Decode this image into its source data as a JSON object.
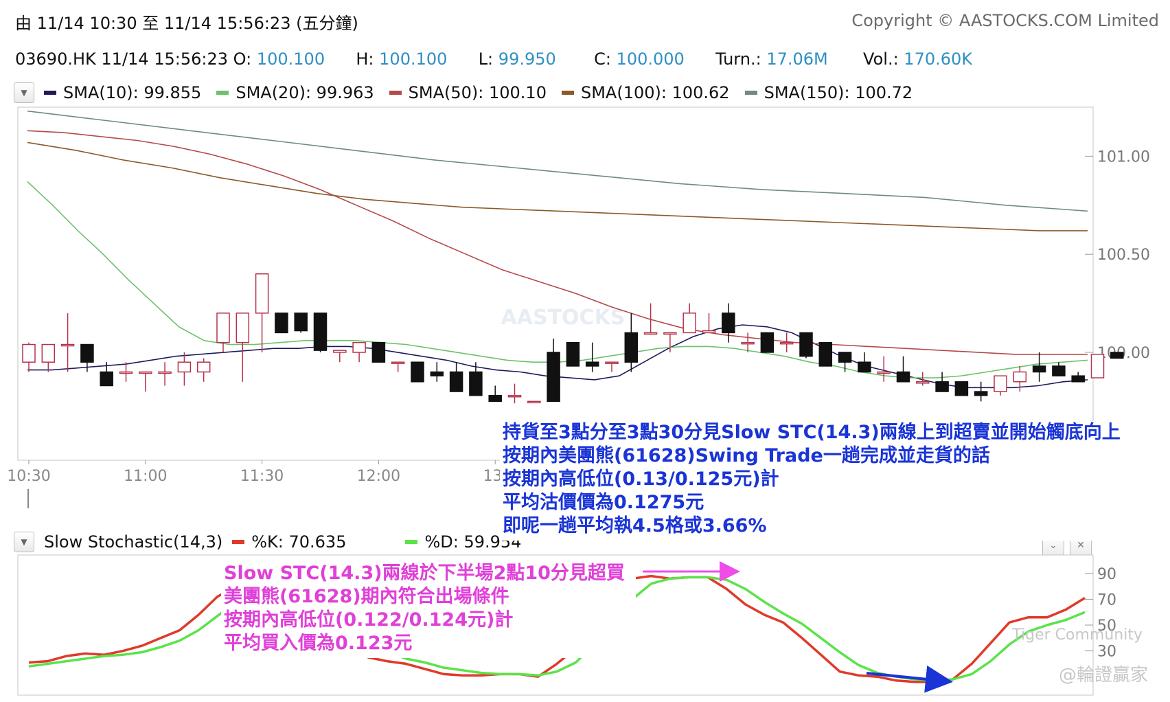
{
  "header": {
    "range_label": "由",
    "range_from": "11/14 10:30",
    "range_to_label": "至",
    "range_to": "11/14 15:56:23",
    "range_mode": "(五分鐘)",
    "copyright": "Copyright © AASTOCKS.COM Limited"
  },
  "quote": {
    "symbol": "03690.HK",
    "time": "11/14 15:56:23",
    "open_label": "O:",
    "open": "100.100",
    "high_label": "H:",
    "high": "100.100",
    "low_label": "L:",
    "low": "99.950",
    "close_label": "C:",
    "close": "100.000",
    "turnover_label": "Turn.:",
    "turnover": "17.06M",
    "volume_label": "Vol.:",
    "volume": "170.60K"
  },
  "sma_legend": [
    {
      "label": "SMA(10): 99.855",
      "color": "#1f1a5e"
    },
    {
      "label": "SMA(20): 99.963",
      "color": "#6cc26c"
    },
    {
      "label": "SMA(50): 100.10",
      "color": "#b5494a"
    },
    {
      "label": "SMA(100): 100.62",
      "color": "#8a5a2a"
    },
    {
      "label": "SMA(150): 100.72",
      "color": "#6f8a86"
    }
  ],
  "stoch_legend": {
    "name": "Slow Stochastic(14,3)",
    "k_label": "%K: 70.635",
    "k_color": "#e03a2a",
    "d_label": "%D: 59.954",
    "d_color": "#5be34a"
  },
  "notes": {
    "blue": [
      "持貨至3點分至3點30分見Slow STC(14.3)兩線上到超賣並開始觸底向上",
      "按期內美團熊(61628)Swing Trade一趟完成並走貨的話",
      "按期內高低位(0.13/0.125元)計",
      "平均沽價價為0.1275元",
      "即呢一趟平均執4.5格或3.66%"
    ],
    "pink": [
      "Slow STC(14.3)兩線於下半場2點10分見超買",
      "美團熊(61628)期內符合出場條件",
      "按期內高低位(0.122/0.124元)計",
      "平均買入價為0.123元"
    ]
  },
  "watermarks": {
    "center": "AASTOCKS",
    "tiger": "Tiger Community",
    "handle": "@輪證贏家"
  },
  "chart_data": [
    {
      "type": "candlestick",
      "interval": "5 minutes",
      "x_ticks": [
        "10:30",
        "11:00",
        "11:30",
        "12:00",
        "13:"
      ],
      "y_ticks": [
        "101.00",
        "100.50",
        "100.00"
      ],
      "ylim": [
        99.45,
        101.25
      ],
      "candles": [
        {
          "o": 99.95,
          "h": 100.05,
          "l": 99.9,
          "c": 100.04
        },
        {
          "o": 99.95,
          "h": 100.04,
          "l": 99.9,
          "c": 100.04
        },
        {
          "o": 100.04,
          "h": 100.2,
          "l": 99.9,
          "c": 100.04
        },
        {
          "o": 100.04,
          "h": 100.04,
          "l": 99.9,
          "c": 99.95
        },
        {
          "o": 99.9,
          "h": 99.95,
          "l": 99.83,
          "c": 99.83
        },
        {
          "o": 99.9,
          "h": 99.95,
          "l": 99.85,
          "c": 99.9
        },
        {
          "o": 99.9,
          "h": 99.9,
          "l": 99.8,
          "c": 99.9
        },
        {
          "o": 99.9,
          "h": 99.95,
          "l": 99.83,
          "c": 99.9
        },
        {
          "o": 99.9,
          "h": 100.0,
          "l": 99.83,
          "c": 99.95
        },
        {
          "o": 99.9,
          "h": 99.97,
          "l": 99.85,
          "c": 99.95
        },
        {
          "o": 100.05,
          "h": 100.2,
          "l": 100.0,
          "c": 100.2
        },
        {
          "o": 100.05,
          "h": 100.2,
          "l": 99.85,
          "c": 100.2
        },
        {
          "o": 100.2,
          "h": 100.35,
          "l": 100.0,
          "c": 100.4
        },
        {
          "o": 100.2,
          "h": 100.2,
          "l": 100.1,
          "c": 100.1
        },
        {
          "o": 100.2,
          "h": 100.2,
          "l": 100.1,
          "c": 100.11
        },
        {
          "o": 100.2,
          "h": 100.2,
          "l": 100.0,
          "c": 100.01
        },
        {
          "o": 100.0,
          "h": 100.0,
          "l": 99.95,
          "c": 100.01
        },
        {
          "o": 100.0,
          "h": 100.05,
          "l": 99.95,
          "c": 100.05
        },
        {
          "o": 100.05,
          "h": 100.05,
          "l": 99.95,
          "c": 99.95
        },
        {
          "o": 99.95,
          "h": 99.95,
          "l": 99.9,
          "c": 99.95
        },
        {
          "o": 99.95,
          "h": 99.95,
          "l": 99.85,
          "c": 99.85
        },
        {
          "o": 99.9,
          "h": 99.95,
          "l": 99.85,
          "c": 99.88
        },
        {
          "o": 99.9,
          "h": 99.95,
          "l": 99.83,
          "c": 99.8
        },
        {
          "o": 99.9,
          "h": 99.95,
          "l": 99.83,
          "c": 99.78
        },
        {
          "o": 99.78,
          "h": 99.83,
          "l": 99.75,
          "c": 99.75
        },
        {
          "o": 99.78,
          "h": 99.84,
          "l": 99.74,
          "c": 99.78
        },
        {
          "o": 99.75,
          "h": 99.75,
          "l": 99.75,
          "c": 99.75
        },
        {
          "o": 100.0,
          "h": 100.07,
          "l": 99.9,
          "c": 99.75
        },
        {
          "o": 100.05,
          "h": 100.05,
          "l": 99.95,
          "c": 99.93
        },
        {
          "o": 99.95,
          "h": 100.05,
          "l": 99.9,
          "c": 99.93
        },
        {
          "o": 99.95,
          "h": 99.9,
          "l": 99.9,
          "c": 99.95
        },
        {
          "o": 100.1,
          "h": 100.2,
          "l": 99.9,
          "c": 99.95
        },
        {
          "o": 100.1,
          "h": 100.25,
          "l": 100.1,
          "c": 100.1
        },
        {
          "o": 100.1,
          "h": 100.05,
          "l": 100.0,
          "c": 100.1
        },
        {
          "o": 100.1,
          "h": 100.25,
          "l": 100.1,
          "c": 100.2
        },
        {
          "o": 100.1,
          "h": 100.2,
          "l": 100.1,
          "c": 100.11
        },
        {
          "o": 100.2,
          "h": 100.25,
          "l": 100.05,
          "c": 100.1
        },
        {
          "o": 100.05,
          "h": 100.1,
          "l": 100.0,
          "c": 100.05
        },
        {
          "o": 100.1,
          "h": 100.1,
          "l": 100.0,
          "c": 100.0
        },
        {
          "o": 100.05,
          "h": 100.1,
          "l": 100.0,
          "c": 100.05
        },
        {
          "o": 100.1,
          "h": 100.1,
          "l": 99.97,
          "c": 99.98
        },
        {
          "o": 100.05,
          "h": 100.05,
          "l": 99.93,
          "c": 99.93
        },
        {
          "o": 100.0,
          "h": 100.0,
          "l": 99.9,
          "c": 99.95
        },
        {
          "o": 99.95,
          "h": 100.0,
          "l": 99.9,
          "c": 99.9
        },
        {
          "o": 99.9,
          "h": 99.98,
          "l": 99.85,
          "c": 99.9
        },
        {
          "o": 99.9,
          "h": 99.98,
          "l": 99.85,
          "c": 99.85
        },
        {
          "o": 99.85,
          "h": 99.9,
          "l": 99.83,
          "c": 99.85
        },
        {
          "o": 99.85,
          "h": 99.9,
          "l": 99.82,
          "c": 99.8
        },
        {
          "o": 99.85,
          "h": 99.85,
          "l": 99.78,
          "c": 99.78
        },
        {
          "o": 99.8,
          "h": 99.85,
          "l": 99.75,
          "c": 99.78
        },
        {
          "o": 99.8,
          "h": 99.85,
          "l": 99.78,
          "c": 99.88
        },
        {
          "o": 99.85,
          "h": 99.93,
          "l": 99.8,
          "c": 99.9
        },
        {
          "o": 99.93,
          "h": 100.0,
          "l": 99.85,
          "c": 99.9
        },
        {
          "o": 99.93,
          "h": 99.95,
          "l": 99.9,
          "c": 99.88
        },
        {
          "o": 99.88,
          "h": 99.9,
          "l": 99.85,
          "c": 99.85
        },
        {
          "o": 99.87,
          "h": 99.9,
          "l": 99.87,
          "c": 99.99
        },
        {
          "o": 100.0,
          "h": 100.0,
          "l": 99.97,
          "c": 99.97
        }
      ],
      "series": [
        {
          "name": "SMA(10)",
          "color": "#1f1a5e",
          "values": [
            99.91,
            99.91,
            99.92,
            99.93,
            99.94,
            99.96,
            99.98,
            99.99,
            100.0,
            100.01,
            100.02,
            100.02,
            100.03,
            100.03,
            100.02,
            100.0,
            99.98,
            99.96,
            99.93,
            99.91,
            99.9,
            99.88,
            99.87,
            99.86,
            99.88,
            99.95,
            100.02,
            100.08,
            100.12,
            100.14,
            100.13,
            100.1,
            100.04,
            99.98,
            99.93,
            99.9,
            99.87,
            99.84,
            99.82,
            99.82,
            99.82,
            99.83,
            99.85,
            99.86
          ]
        },
        {
          "name": "SMA(20)",
          "color": "#6cc26c",
          "values": [
            100.87,
            100.75,
            100.62,
            100.5,
            100.37,
            100.25,
            100.13,
            100.06,
            100.04,
            100.04,
            100.05,
            100.06,
            100.06,
            100.06,
            100.05,
            100.04,
            100.02,
            100.0,
            99.98,
            99.96,
            99.95,
            99.95,
            99.96,
            99.98,
            100.0,
            100.02,
            100.03,
            100.03,
            100.02,
            100.0,
            99.98,
            99.95,
            99.93,
            99.9,
            99.88,
            99.87,
            99.87,
            99.88,
            99.9,
            99.92,
            99.94,
            99.95,
            99.96
          ]
        },
        {
          "name": "SMA(50)",
          "color": "#b5494a",
          "values": [
            101.13,
            101.12,
            101.1,
            101.08,
            101.05,
            101.01,
            100.96,
            100.9,
            100.83,
            100.75,
            100.67,
            100.58,
            100.5,
            100.42,
            100.36,
            100.3,
            100.23,
            100.17,
            100.12,
            100.09,
            100.07,
            100.05,
            100.04,
            100.03,
            100.02,
            100.01,
            100.0,
            99.99,
            99.99,
            99.99
          ]
        },
        {
          "name": "SMA(100)",
          "color": "#8a5a2a",
          "values": [
            101.07,
            101.03,
            100.98,
            100.94,
            100.89,
            100.85,
            100.81,
            100.78,
            100.76,
            100.74,
            100.73,
            100.72,
            100.71,
            100.7,
            100.69,
            100.68,
            100.67,
            100.66,
            100.65,
            100.64,
            100.63,
            100.62,
            100.62
          ]
        },
        {
          "name": "SMA(150)",
          "color": "#6f8a86",
          "values": [
            101.23,
            101.18,
            101.13,
            101.08,
            101.03,
            100.98,
            100.94,
            100.9,
            100.86,
            100.83,
            100.81,
            100.79,
            100.75,
            100.72
          ]
        }
      ]
    },
    {
      "type": "line",
      "title": "Slow Stochastic(14,3)",
      "y_ticks": [
        "90",
        "70",
        "50",
        "30"
      ],
      "ylim": [
        0,
        100
      ],
      "series": [
        {
          "name": "%K",
          "color": "#e03a2a",
          "values": [
            21,
            22,
            26,
            28,
            27,
            30,
            34,
            40,
            46,
            58,
            72,
            80,
            82,
            80,
            70,
            55,
            44,
            32,
            25,
            22,
            20,
            16,
            12,
            11,
            11,
            12,
            12,
            10,
            20,
            32,
            52,
            72,
            86,
            88,
            86,
            87,
            87,
            78,
            66,
            58,
            52,
            40,
            27,
            14,
            11,
            10,
            7,
            6,
            6,
            8,
            20,
            36,
            52,
            56,
            56,
            62,
            71
          ]
        },
        {
          "name": "%D",
          "color": "#5be34a",
          "values": [
            18,
            20,
            22,
            24,
            26,
            27,
            29,
            33,
            38,
            46,
            57,
            68,
            75,
            79,
            78,
            70,
            58,
            46,
            36,
            29,
            24,
            21,
            17,
            15,
            13,
            12,
            12,
            11,
            14,
            21,
            35,
            52,
            70,
            82,
            86,
            87,
            87,
            85,
            78,
            68,
            59,
            51,
            40,
            29,
            19,
            13,
            10,
            8,
            7,
            8,
            12,
            22,
            35,
            45,
            50,
            54,
            60
          ]
        }
      ]
    }
  ]
}
